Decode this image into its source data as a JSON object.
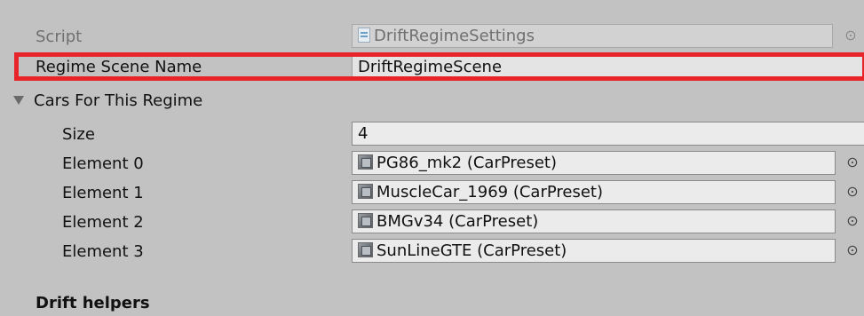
{
  "inspector": {
    "script": {
      "label": "Script",
      "value": "DriftRegimeSettings",
      "icon": "script-file-icon"
    },
    "regime_scene_name": {
      "label": "Regime Scene Name",
      "value": "DriftRegimeScene"
    },
    "cars_for_this_regime": {
      "label": "Cars For This Regime",
      "expanded": true,
      "size_label": "Size",
      "size_value": "4",
      "elements": [
        {
          "label": "Element 0",
          "value": "PG86_mk2 (CarPreset)"
        },
        {
          "label": "Element 1",
          "value": "MuscleCar_1969 (CarPreset)"
        },
        {
          "label": "Element 2",
          "value": "BMGv34 (CarPreset)"
        },
        {
          "label": "Element 3",
          "value": "SunLineGTE (CarPreset)"
        }
      ]
    },
    "drift_helpers_header": "Drift helpers",
    "picker_glyph": "⊙",
    "highlight_color": "#e8242b"
  }
}
